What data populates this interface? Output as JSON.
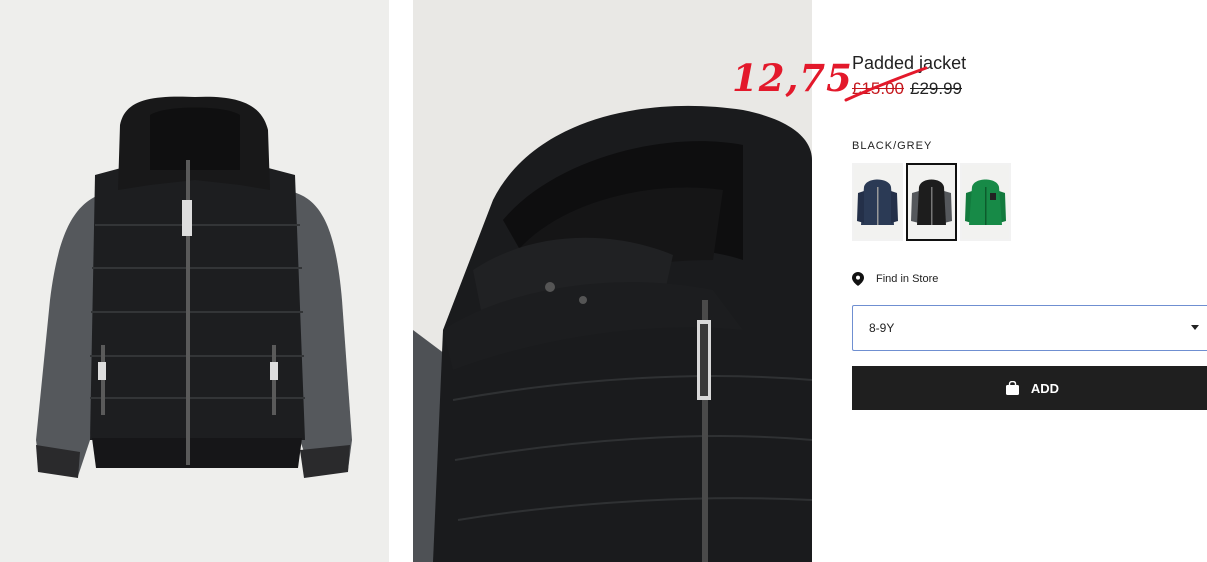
{
  "product": {
    "title": "Padded jacket",
    "price_sale": "£15.00",
    "price_original": "£29.99",
    "handwritten_price": "12,75",
    "color_label": "BLACK/GREY",
    "swatches": [
      {
        "name": "navy",
        "color": "#2b3a55"
      },
      {
        "name": "black-grey",
        "color": "#1d1d1d",
        "selected": true
      },
      {
        "name": "green",
        "color": "#178a47"
      }
    ],
    "find_in_store": "Find in Store",
    "size_selected": "8-9Y",
    "add_label": "ADD"
  },
  "colors": {
    "sale": "#c4161c",
    "handwriting": "#e3192b",
    "button": "#1f1f1f",
    "select_border": "#6f8fd1"
  },
  "icons": [
    "location-pin-icon",
    "shopping-bag-icon",
    "chevron-down-icon"
  ]
}
